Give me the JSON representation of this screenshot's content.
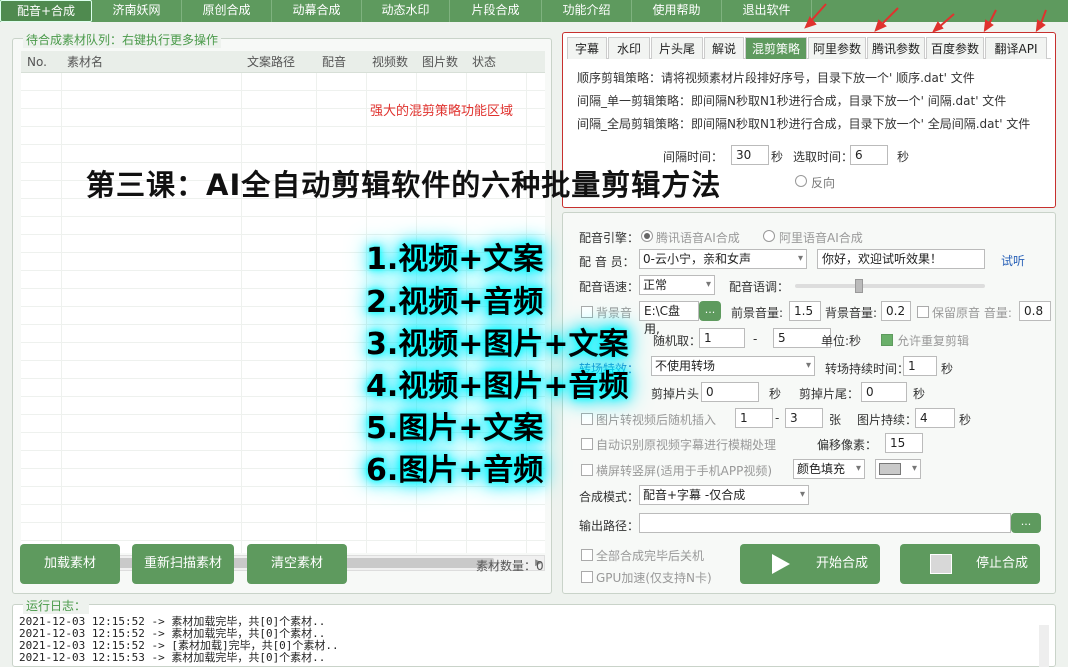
{
  "menu": [
    "配音+合成",
    "济南妖网",
    "原创合成",
    "动幕合成",
    "动态水印",
    "片段合成",
    "功能介绍",
    "使用帮助",
    "退出软件"
  ],
  "queue": {
    "title": "待合成素材队列：右键执行更多操作",
    "columns": [
      "No.",
      "素材名",
      "文案路径",
      "配音",
      "视频数",
      "图片数",
      "状态"
    ],
    "buttons": [
      "加载素材",
      "重新扫描素材",
      "清空素材"
    ],
    "count_label": "素材数量：0"
  },
  "red_hint": "强大的混剪策略功能区域",
  "strategy": {
    "tabs": [
      "字幕",
      "水印",
      "片头尾",
      "解说",
      "混剪策略",
      "阿里参数",
      "腾讯参数",
      "百度参数",
      "翻译API"
    ],
    "active_tab": "混剪策略",
    "lines": [
      "顺序剪辑策略：请将视频素材片段排好序号，目录下放一个' 顺序.dat' 文件",
      "间隔_单一剪辑策略：即间隔N秒取N1秒进行合成，目录下放一个' 间隔.dat' 文件",
      "间隔_全局剪辑策略：即间隔N秒取N1秒进行合成，目录下放一个' 全局间隔.dat' 文件"
    ],
    "interval_label": "间隔时间：",
    "interval_value": "30",
    "sec_label": "秒",
    "take_label": "选取时间：",
    "take_value": "6",
    "reverse_label": "反向"
  },
  "overlay": {
    "title": "第三课：AI全自动剪辑软件的六种批量剪辑方法",
    "methods": [
      "1.视频+文案",
      "2.视频+音频",
      "3.视频+图片+文案",
      "4.视频+图片+音频",
      "5.图片+文案",
      "6.图片+音频"
    ]
  },
  "settings": {
    "engine_label": "配音引擎：",
    "engine_tencent": "腾讯语音AI合成",
    "engine_ali": "阿里语音AI合成",
    "voice_label": "配 音 员：",
    "voice_value": "0-云小宁，亲和女声",
    "preview_text": "你好，欢迎试听效果！",
    "listen_link": "试听",
    "speed_label": "配音语速：",
    "speed_value": "正常",
    "pitch_label": "配音语调：",
    "bgm_label": "背景音",
    "bgm_path": "E:\\C盘 用,",
    "browse": "...",
    "front_vol_label": "前景音量:",
    "front_vol": "1.5",
    "back_vol_label": "背景音量:",
    "back_vol": "0.2",
    "keep_orig_label": "保留原音 音量:",
    "keep_orig_vol": "0.8",
    "random_label": "随机取：",
    "random_min": "1",
    "dash": "-",
    "random_max": "5",
    "unit_label": "单位:秒",
    "allow_repeat": "允许重复剪辑",
    "transition_label": "转场特效：",
    "transition_value": "不使用转场",
    "trans_dur_label": "转场持续时间：",
    "trans_dur": "1",
    "sec": "秒",
    "cut_head_label": "剪掉片头：",
    "cut_head": "0",
    "cut_tail_label": "剪掉片尾：",
    "cut_tail": "0",
    "img_insert_label": "图片转视频后随机插入",
    "img_min": "1",
    "img_max": "3",
    "img_unit": "张",
    "img_dur_label": "图片持续：",
    "img_dur": "4",
    "subtitle_blur_label": "自动识别原视频字幕进行模糊处理",
    "offset_label": "偏移像素：",
    "offset": "15",
    "landscape_label": "横屏转竖屏(适用于手机APP视频)",
    "fill_value": "颜色填充",
    "mode_label": "合成模式：",
    "mode_value": "配音+字幕 -仅合成",
    "output_label": "输出路径：",
    "shutdown_label": "全部合成完毕后关机",
    "gpu_label": "GPU加速(仅支持N卡)",
    "start_button": "开始合成",
    "stop_button": "停止合成"
  },
  "log": {
    "title": "运行日志：",
    "lines": [
      "2021-12-03 12:15:52 -> 素材加载完毕，共[0]个素材..",
      "2021-12-03 12:15:52 -> 素材加载完毕，共[0]个素材..",
      "2021-12-03 12:15:52 -> [素材加载]完毕，共[0]个素材..",
      "2021-12-03 12:15:53 -> 素材加载完毕，共[0]个素材.."
    ]
  },
  "colors": {
    "accent": "#5e9a5e",
    "highlight": "#c7302e",
    "glow": "#00ffff"
  }
}
